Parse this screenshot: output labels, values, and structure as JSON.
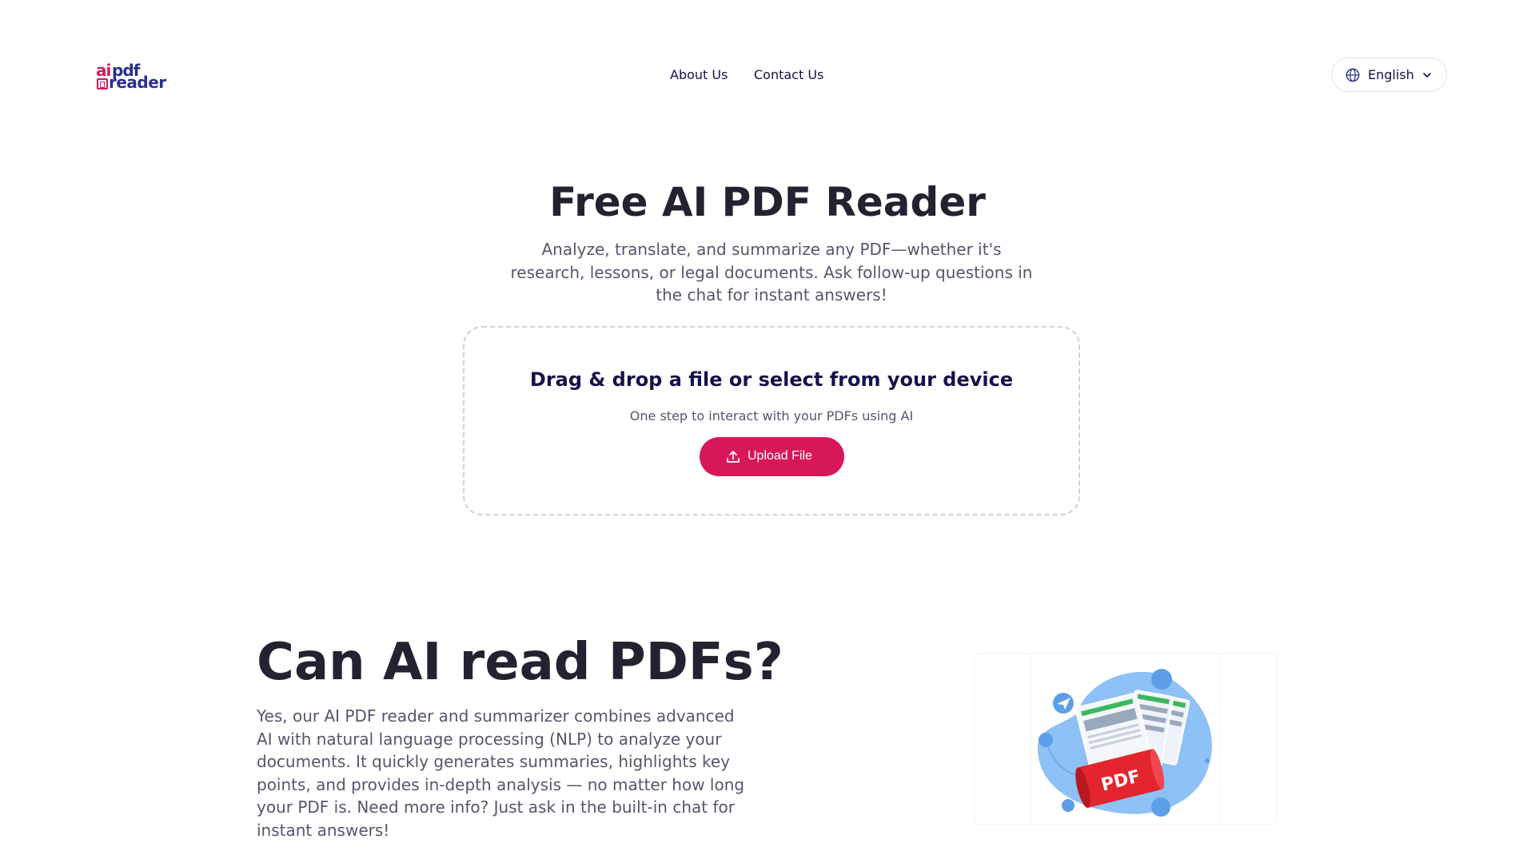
{
  "logo": {
    "ai": "ai",
    "pdf": "pdf",
    "reader": "reader"
  },
  "nav": {
    "about": "About Us",
    "contact": "Contact Us"
  },
  "language": {
    "label": "English",
    "icon": "globe-icon"
  },
  "hero": {
    "title": "Free AI PDF Reader",
    "subtitle": "Analyze, translate, and summarize any PDF—whether it's research, lessons, or legal documents. Ask follow-up questions in the chat for instant answers!"
  },
  "dropzone": {
    "title": "Drag & drop a file or select from your device",
    "subtitle": "One step to interact with your PDFs using AI",
    "button": "Upload File",
    "button_icon": "upload-icon"
  },
  "section2": {
    "title": "Can AI read PDFs?",
    "body": "Yes, our AI PDF reader and summarizer combines advanced AI with natural language processing (NLP) to analyze your documents. It quickly generates summaries, highlights key points, and provides in-depth analysis — no matter how long your PDF is. Need more info? Just ask in the built-in chat for instant answers!",
    "illustration_label": "PDF"
  },
  "colors": {
    "brand_pink": "#d8175a",
    "brand_navy": "#16124a",
    "text_dark": "#222230",
    "text_muted": "#55566a",
    "illus_blue": "#8ec1f5",
    "illus_red": "#e3262e"
  }
}
